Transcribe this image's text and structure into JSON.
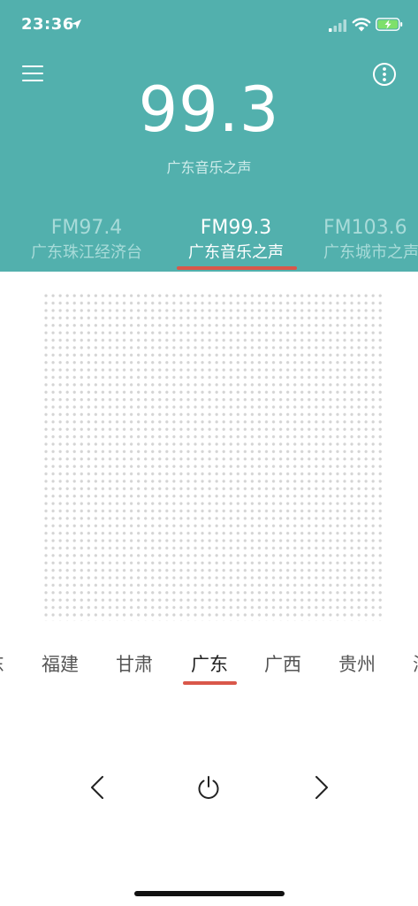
{
  "status_bar": {
    "time": "23:36",
    "icons": [
      "location-arrow-icon",
      "cellular-signal-icon",
      "wifi-icon",
      "battery-charging-icon"
    ]
  },
  "colors": {
    "header_bg": "#52b0ad",
    "accent": "#d9574a"
  },
  "header": {
    "menu_icon": "hamburger-menu-icon",
    "more_icon": "more-options-icon",
    "current_frequency": "99.3",
    "current_station_name": "广东音乐之声"
  },
  "stations": [
    {
      "frequency": "FM97.4",
      "name": "广东珠江经济台",
      "active": false
    },
    {
      "frequency": "FM99.3",
      "name": "广东音乐之声",
      "active": true
    },
    {
      "frequency": "FM103.6",
      "name": "广东城市之声",
      "active": false
    }
  ],
  "provinces": [
    {
      "name": "广东",
      "active": false
    },
    {
      "name": "福建",
      "active": false
    },
    {
      "name": "甘肃",
      "active": false
    },
    {
      "name": "广东",
      "active": true
    },
    {
      "name": "广西",
      "active": false
    },
    {
      "name": "贵州",
      "active": false
    },
    {
      "name": "海南",
      "active": false
    }
  ],
  "controls": {
    "previous_icon": "chevron-left-icon",
    "power_icon": "power-icon",
    "next_icon": "chevron-right-icon"
  }
}
